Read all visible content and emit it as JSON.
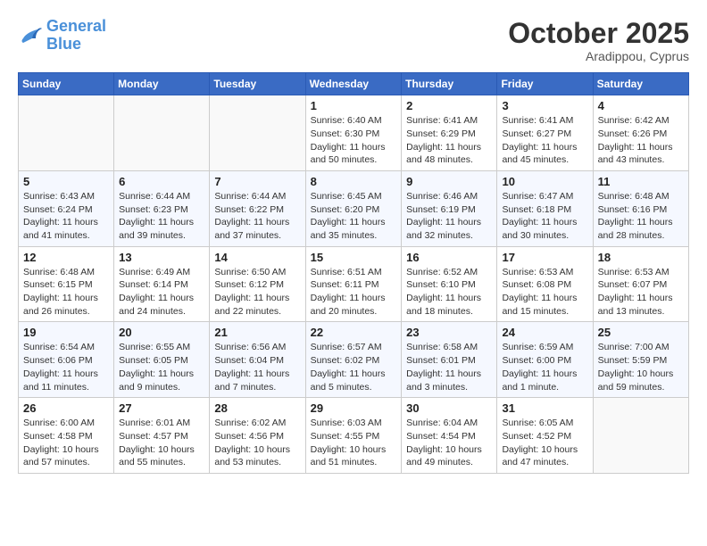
{
  "header": {
    "logo_line1": "General",
    "logo_line2": "Blue",
    "month": "October 2025",
    "location": "Aradippou, Cyprus"
  },
  "weekdays": [
    "Sunday",
    "Monday",
    "Tuesday",
    "Wednesday",
    "Thursday",
    "Friday",
    "Saturday"
  ],
  "weeks": [
    [
      {
        "day": "",
        "info": ""
      },
      {
        "day": "",
        "info": ""
      },
      {
        "day": "",
        "info": ""
      },
      {
        "day": "1",
        "info": "Sunrise: 6:40 AM\nSunset: 6:30 PM\nDaylight: 11 hours\nand 50 minutes."
      },
      {
        "day": "2",
        "info": "Sunrise: 6:41 AM\nSunset: 6:29 PM\nDaylight: 11 hours\nand 48 minutes."
      },
      {
        "day": "3",
        "info": "Sunrise: 6:41 AM\nSunset: 6:27 PM\nDaylight: 11 hours\nand 45 minutes."
      },
      {
        "day": "4",
        "info": "Sunrise: 6:42 AM\nSunset: 6:26 PM\nDaylight: 11 hours\nand 43 minutes."
      }
    ],
    [
      {
        "day": "5",
        "info": "Sunrise: 6:43 AM\nSunset: 6:24 PM\nDaylight: 11 hours\nand 41 minutes."
      },
      {
        "day": "6",
        "info": "Sunrise: 6:44 AM\nSunset: 6:23 PM\nDaylight: 11 hours\nand 39 minutes."
      },
      {
        "day": "7",
        "info": "Sunrise: 6:44 AM\nSunset: 6:22 PM\nDaylight: 11 hours\nand 37 minutes."
      },
      {
        "day": "8",
        "info": "Sunrise: 6:45 AM\nSunset: 6:20 PM\nDaylight: 11 hours\nand 35 minutes."
      },
      {
        "day": "9",
        "info": "Sunrise: 6:46 AM\nSunset: 6:19 PM\nDaylight: 11 hours\nand 32 minutes."
      },
      {
        "day": "10",
        "info": "Sunrise: 6:47 AM\nSunset: 6:18 PM\nDaylight: 11 hours\nand 30 minutes."
      },
      {
        "day": "11",
        "info": "Sunrise: 6:48 AM\nSunset: 6:16 PM\nDaylight: 11 hours\nand 28 minutes."
      }
    ],
    [
      {
        "day": "12",
        "info": "Sunrise: 6:48 AM\nSunset: 6:15 PM\nDaylight: 11 hours\nand 26 minutes."
      },
      {
        "day": "13",
        "info": "Sunrise: 6:49 AM\nSunset: 6:14 PM\nDaylight: 11 hours\nand 24 minutes."
      },
      {
        "day": "14",
        "info": "Sunrise: 6:50 AM\nSunset: 6:12 PM\nDaylight: 11 hours\nand 22 minutes."
      },
      {
        "day": "15",
        "info": "Sunrise: 6:51 AM\nSunset: 6:11 PM\nDaylight: 11 hours\nand 20 minutes."
      },
      {
        "day": "16",
        "info": "Sunrise: 6:52 AM\nSunset: 6:10 PM\nDaylight: 11 hours\nand 18 minutes."
      },
      {
        "day": "17",
        "info": "Sunrise: 6:53 AM\nSunset: 6:08 PM\nDaylight: 11 hours\nand 15 minutes."
      },
      {
        "day": "18",
        "info": "Sunrise: 6:53 AM\nSunset: 6:07 PM\nDaylight: 11 hours\nand 13 minutes."
      }
    ],
    [
      {
        "day": "19",
        "info": "Sunrise: 6:54 AM\nSunset: 6:06 PM\nDaylight: 11 hours\nand 11 minutes."
      },
      {
        "day": "20",
        "info": "Sunrise: 6:55 AM\nSunset: 6:05 PM\nDaylight: 11 hours\nand 9 minutes."
      },
      {
        "day": "21",
        "info": "Sunrise: 6:56 AM\nSunset: 6:04 PM\nDaylight: 11 hours\nand 7 minutes."
      },
      {
        "day": "22",
        "info": "Sunrise: 6:57 AM\nSunset: 6:02 PM\nDaylight: 11 hours\nand 5 minutes."
      },
      {
        "day": "23",
        "info": "Sunrise: 6:58 AM\nSunset: 6:01 PM\nDaylight: 11 hours\nand 3 minutes."
      },
      {
        "day": "24",
        "info": "Sunrise: 6:59 AM\nSunset: 6:00 PM\nDaylight: 11 hours\nand 1 minute."
      },
      {
        "day": "25",
        "info": "Sunrise: 7:00 AM\nSunset: 5:59 PM\nDaylight: 10 hours\nand 59 minutes."
      }
    ],
    [
      {
        "day": "26",
        "info": "Sunrise: 6:00 AM\nSunset: 4:58 PM\nDaylight: 10 hours\nand 57 minutes."
      },
      {
        "day": "27",
        "info": "Sunrise: 6:01 AM\nSunset: 4:57 PM\nDaylight: 10 hours\nand 55 minutes."
      },
      {
        "day": "28",
        "info": "Sunrise: 6:02 AM\nSunset: 4:56 PM\nDaylight: 10 hours\nand 53 minutes."
      },
      {
        "day": "29",
        "info": "Sunrise: 6:03 AM\nSunset: 4:55 PM\nDaylight: 10 hours\nand 51 minutes."
      },
      {
        "day": "30",
        "info": "Sunrise: 6:04 AM\nSunset: 4:54 PM\nDaylight: 10 hours\nand 49 minutes."
      },
      {
        "day": "31",
        "info": "Sunrise: 6:05 AM\nSunset: 4:52 PM\nDaylight: 10 hours\nand 47 minutes."
      },
      {
        "day": "",
        "info": ""
      }
    ]
  ]
}
